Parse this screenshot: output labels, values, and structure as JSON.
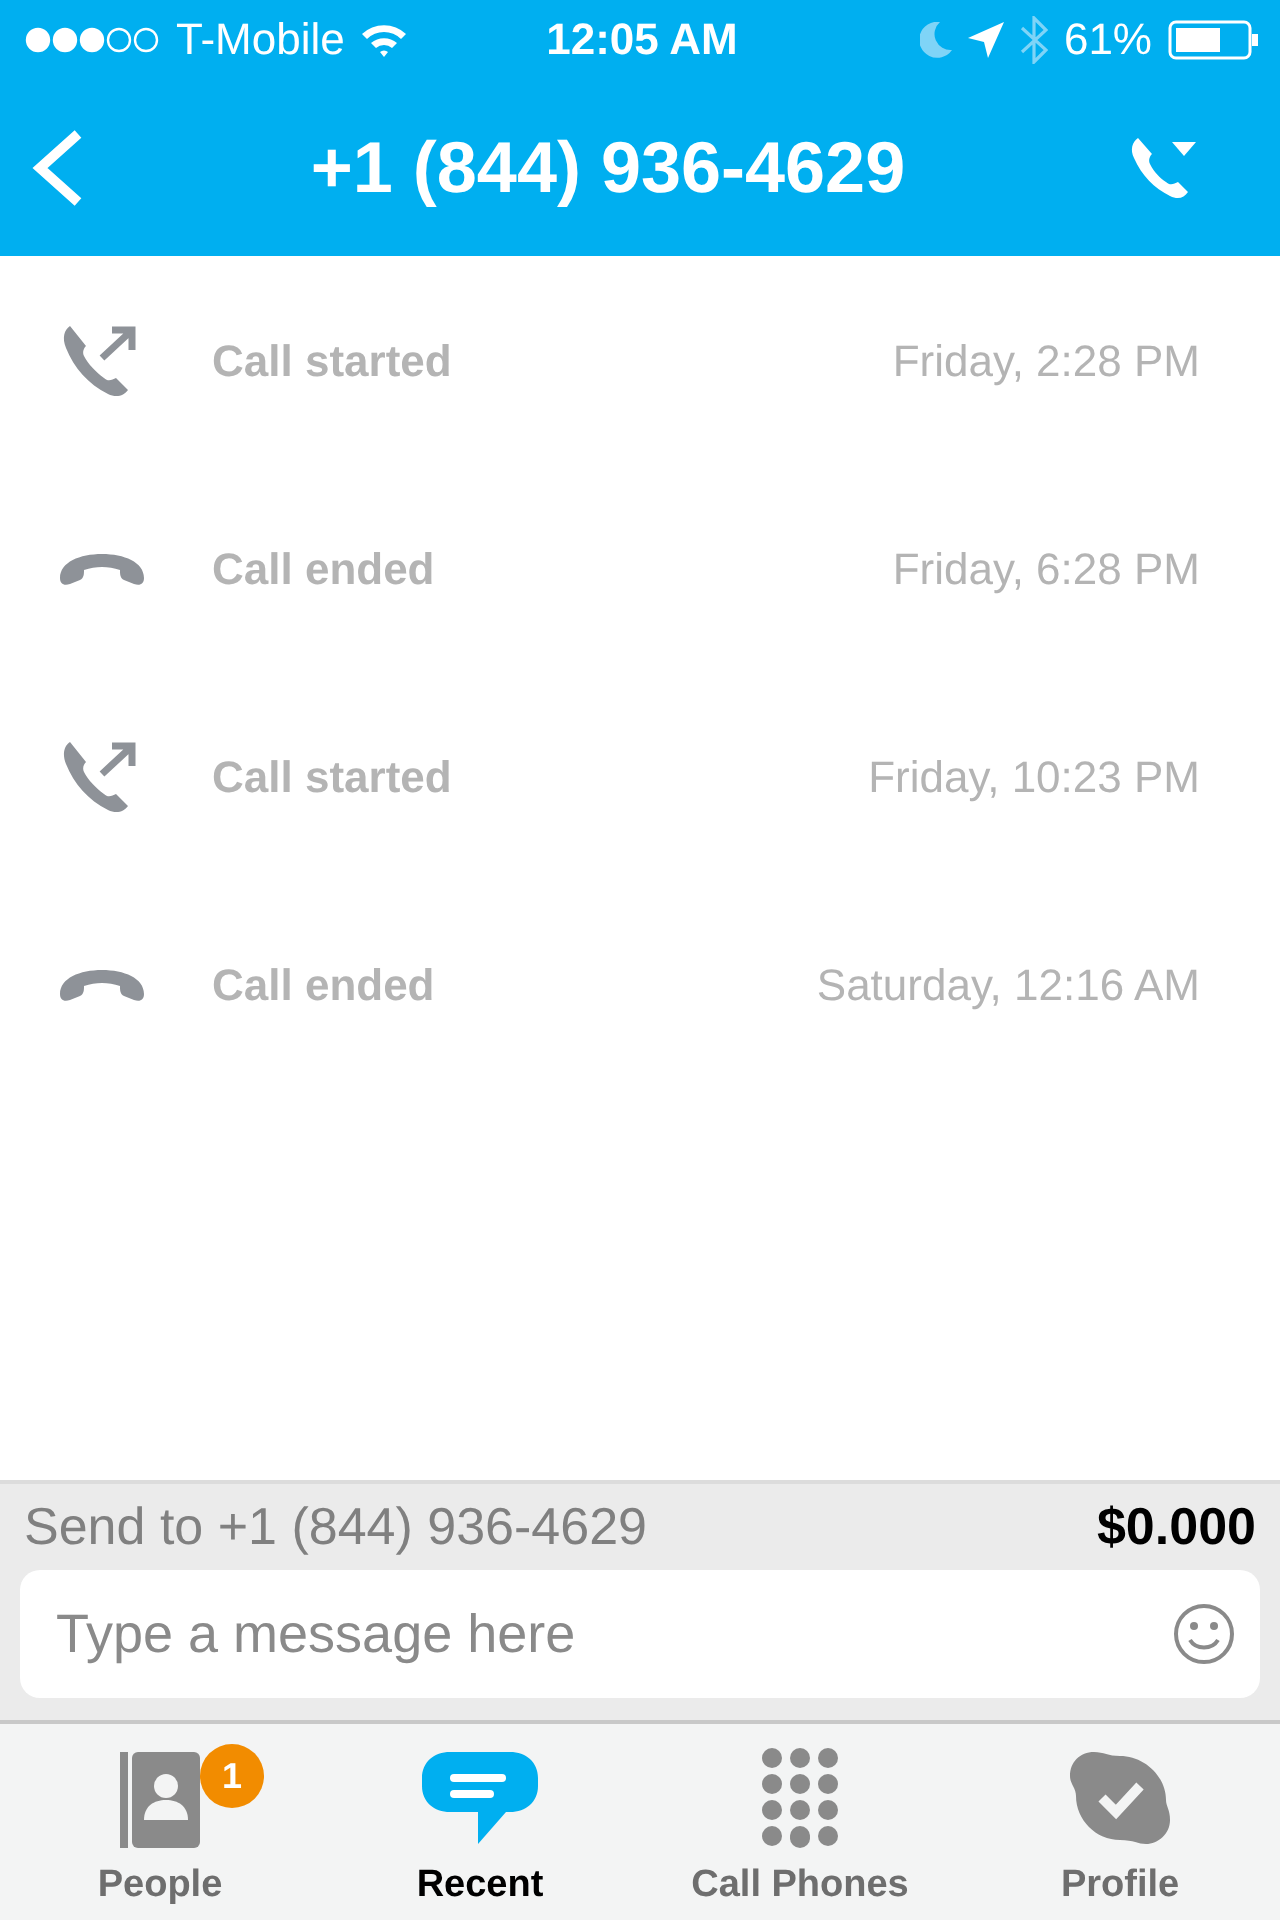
{
  "status_bar": {
    "carrier": "T-Mobile",
    "time": "12:05 AM",
    "battery": "61%"
  },
  "nav": {
    "title": "+1 (844) 936-4629"
  },
  "calls": [
    {
      "kind": "started",
      "label": "Call started",
      "time": "Friday, 2:28 PM"
    },
    {
      "kind": "ended",
      "label": "Call ended",
      "time": "Friday, 6:28 PM"
    },
    {
      "kind": "started",
      "label": "Call started",
      "time": "Friday, 10:23 PM"
    },
    {
      "kind": "ended",
      "label": "Call ended",
      "time": "Saturday, 12:16 AM"
    }
  ],
  "composer": {
    "send_to": "Send to +1 (844) 936-4629",
    "credit": "$0.000",
    "placeholder": "Type a message here"
  },
  "tabs": [
    {
      "kind": "people",
      "label": "People",
      "selected": false,
      "badge": "1"
    },
    {
      "kind": "recent",
      "label": "Recent",
      "selected": true
    },
    {
      "kind": "dialpad",
      "label": "Call Phones",
      "selected": false
    },
    {
      "kind": "profile",
      "label": "Profile",
      "selected": false
    }
  ]
}
